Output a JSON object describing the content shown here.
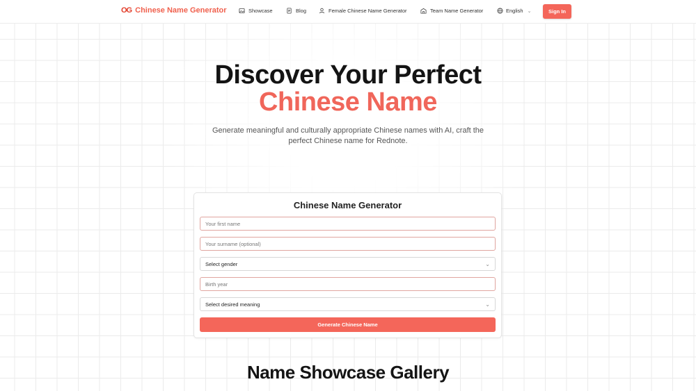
{
  "header": {
    "logo_mark": "OG",
    "brand": "Chinese Name Generator",
    "nav": [
      {
        "label": "Showcase",
        "icon": "image-icon"
      },
      {
        "label": "Blog",
        "icon": "document-icon"
      },
      {
        "label": "Female Chinese Name Generator",
        "icon": "user-icon"
      },
      {
        "label": "Team Name Generator",
        "icon": "building-icon"
      }
    ],
    "language": "English",
    "signin_label": "Sign In"
  },
  "hero": {
    "title_line1": "Discover Your Perfect",
    "title_line2": "Chinese Name",
    "subtitle": "Generate meaningful and culturally appropriate Chinese names with AI, craft the perfect Chinese name for Rednote."
  },
  "form": {
    "title": "Chinese Name Generator",
    "first_name_placeholder": "Your first name",
    "surname_placeholder": "Your surname (optional)",
    "gender_select": "Select gender",
    "birth_year_placeholder": "Birth year",
    "meaning_select": "Select desired meaning",
    "submit_label": "Generate Chinese Name"
  },
  "gallery": {
    "title": "Name Showcase Gallery"
  },
  "colors": {
    "accent": "#f4665a",
    "brand_text": "#f0604d",
    "grid": "#ebebeb"
  }
}
